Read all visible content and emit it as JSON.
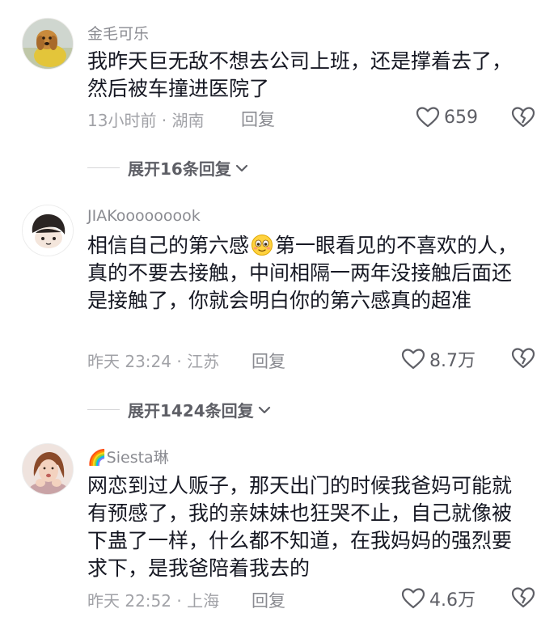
{
  "comments": [
    {
      "username": "金毛可乐",
      "content": "我昨天巨无敌不想去公司上班，还是撑着去了，然后被车撞进医院了",
      "time_location": "13小时前 · 湖南",
      "reply_label": "回复",
      "likes": "659",
      "expand_label": "展开16条回复"
    },
    {
      "username": "JIAKooooooook",
      "content_before_emoji": "相信自己的第六感",
      "content_after_emoji": "第一眼看见的不喜欢的人，真的不要去接触，中间相隔一两年没接触后面还是接触了，你就会明白你的第六感真的超准",
      "time_location": "昨天 23:24 · 江苏",
      "reply_label": "回复",
      "likes": "8.7万",
      "expand_label": "展开1424条回复"
    },
    {
      "username_emoji": "🌈",
      "username": "Siesta琳",
      "content": "网恋到过人贩子，那天出门的时候我爸妈可能就有预感了，我的亲妹妹也狂哭不止，自己就像被下蛊了一样，什么都不知道，在我妈妈的强烈要求下，是我爸陪着我去的",
      "time_location": "昨天 22:52 · 上海",
      "reply_label": "回复",
      "likes": "4.6万"
    }
  ],
  "icons": {
    "like": "heart-outline-icon",
    "dislike": "broken-heart-icon",
    "expand": "chevron-down-icon",
    "inline_emoji": "smiling-face-emoji"
  },
  "colors": {
    "text_primary": "#161823",
    "text_secondary": "#8a8b91",
    "text_meta": "#a1a2a7"
  }
}
